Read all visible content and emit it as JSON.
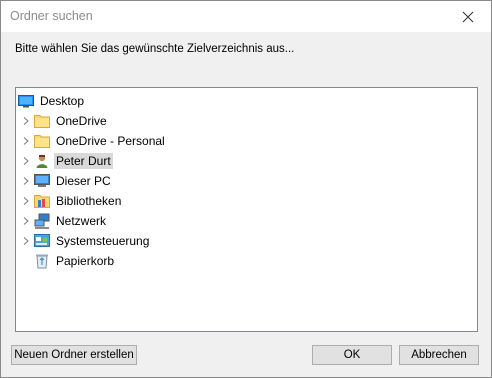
{
  "window": {
    "title": "Ordner suchen"
  },
  "instruction": "Bitte wählen Sie das gewünschte Zielverzeichnis aus...",
  "tree": {
    "root": "Desktop",
    "items": [
      {
        "label": "OneDrive",
        "icon": "folder-icon"
      },
      {
        "label": "OneDrive - Personal",
        "icon": "folder-icon"
      },
      {
        "label": "Peter Durt",
        "icon": "user-icon",
        "selected": true
      },
      {
        "label": "Dieser PC",
        "icon": "computer-icon"
      },
      {
        "label": "Bibliotheken",
        "icon": "libraries-icon"
      },
      {
        "label": "Netzwerk",
        "icon": "network-icon"
      },
      {
        "label": "Systemsteuerung",
        "icon": "control-panel-icon"
      },
      {
        "label": "Papierkorb",
        "icon": "recycle-bin-icon"
      }
    ]
  },
  "buttons": {
    "new_folder": "Neuen Ordner erstellen",
    "ok": "OK",
    "cancel": "Abbrechen"
  }
}
